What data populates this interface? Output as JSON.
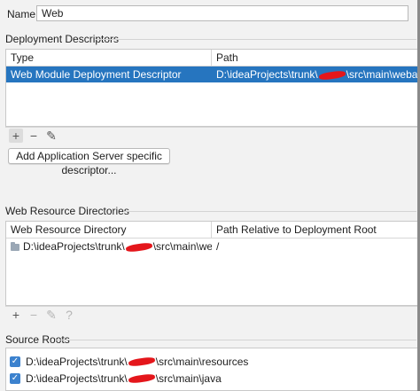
{
  "name_field": {
    "label": "Name:",
    "value": "Web"
  },
  "deployment_descriptors": {
    "title": "Deployment Descriptors",
    "columns": [
      "Type",
      "Path"
    ],
    "rows": [
      {
        "type": "Web Module Deployment Descriptor",
        "path_prefix": "D:\\ideaProjects\\trunk\\",
        "path_suffix": "\\src\\main\\webapp\\WEB-INF"
      }
    ],
    "toolbar": {
      "add": "+",
      "remove": "−",
      "edit": "✎"
    },
    "add_server_button": "Add Application Server specific descriptor..."
  },
  "web_resource_directories": {
    "title": "Web Resource Directories",
    "columns": [
      "Web Resource Directory",
      "Path Relative to Deployment Root"
    ],
    "rows": [
      {
        "dir_prefix": "D:\\ideaProjects\\trunk\\",
        "dir_suffix": "\\src\\main\\webapp",
        "relative": "/"
      }
    ],
    "toolbar": {
      "add": "+",
      "remove": "−",
      "edit": "✎",
      "help": "?"
    }
  },
  "source_roots": {
    "title": "Source Roots",
    "items": [
      {
        "prefix": "D:\\ideaProjects\\trunk\\",
        "suffix": "\\src\\main\\resources",
        "checked": true
      },
      {
        "prefix": "D:\\ideaProjects\\trunk\\",
        "suffix": "\\src\\main\\java",
        "checked": true
      }
    ]
  },
  "colors": {
    "selection": "#2675bf",
    "checkbox": "#3c82ce",
    "redaction": "#e4161b"
  }
}
